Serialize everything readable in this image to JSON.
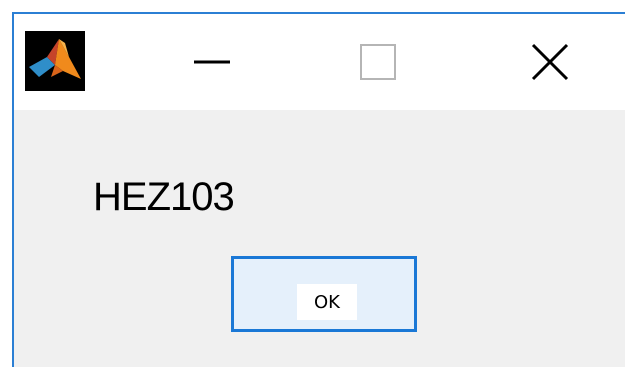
{
  "window": {
    "title_icon": "matlab-logo-icon",
    "controls": {
      "minimize_icon": "minimize-icon",
      "maximize_icon": "maximize-icon",
      "close_icon": "close-icon"
    }
  },
  "dialog": {
    "message": "HEZ103",
    "ok_label": "OK"
  },
  "colors": {
    "accent_border": "#2b7fd4",
    "button_border": "#1a78d6",
    "button_fill": "#e5f0fb",
    "dialog_background": "#f0f0f0"
  }
}
